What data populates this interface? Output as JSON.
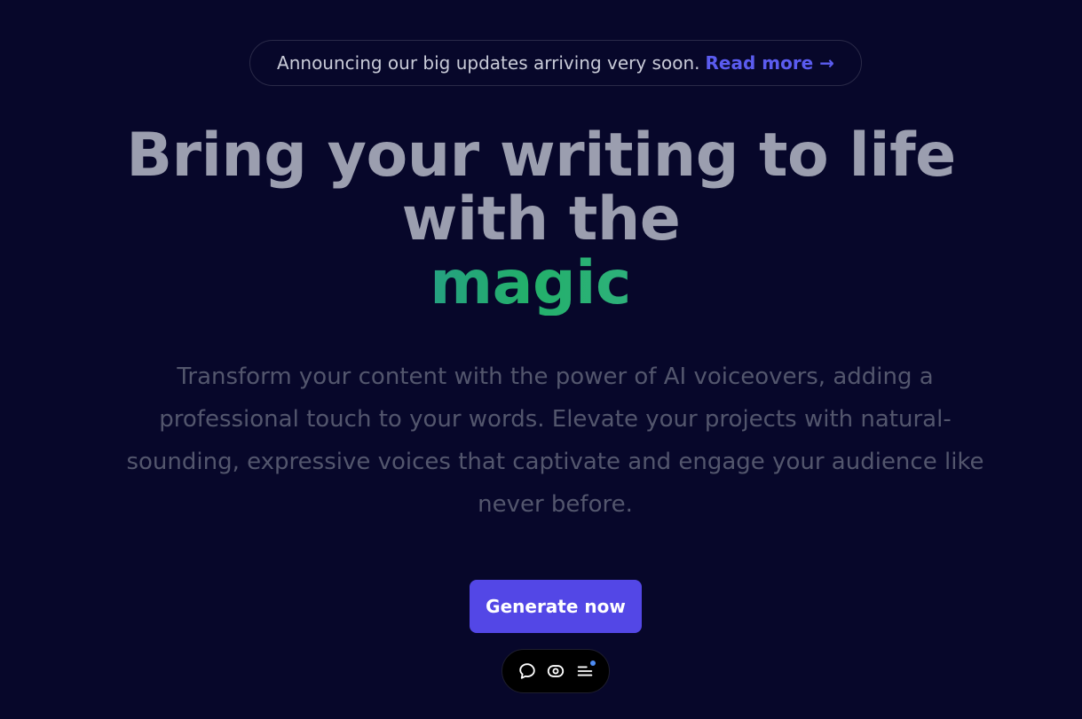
{
  "announcement": {
    "text": "Announcing our big updates arriving very soon.",
    "link_label": "Read more →"
  },
  "hero": {
    "title_line1": "Bring your writing to life",
    "title_line2": "with the",
    "title_highlight": "magic",
    "description": "Transform your content with the power of AI voiceovers, adding a professional touch to your words. Elevate your projects with natural-sounding, expressive voices that captivate and engage your audience like never before.",
    "cta_label": "Generate now"
  },
  "toolbar": {
    "icons": [
      "chat-bubble-icon",
      "eye-icon",
      "menu-icon"
    ]
  },
  "colors": {
    "background": "#07072a",
    "accent": "#5347e6",
    "link": "#5b5cf0",
    "headline": "#9b9eaf",
    "notification_dot": "#4d8cf5"
  }
}
